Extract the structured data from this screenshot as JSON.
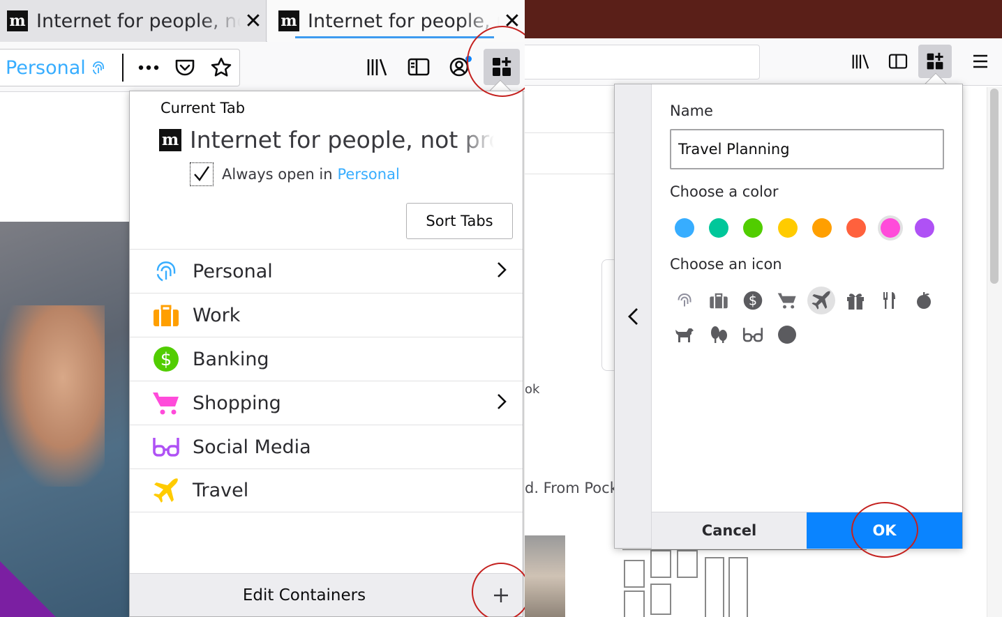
{
  "left": {
    "tabs": [
      {
        "title": "Internet for people, not profit",
        "favicon": "m",
        "close": "✕"
      },
      {
        "title": "Internet for people, not profit",
        "favicon": "m",
        "close": "✕"
      }
    ],
    "navbar": {
      "container_label": "Personal",
      "icons": [
        "fingerprint-icon",
        "more-icon",
        "pocket-icon",
        "star-icon",
        "library-icon",
        "sidebar-icon",
        "account-icon",
        "containers-icon"
      ]
    },
    "popup": {
      "current_tab_label": "Current Tab",
      "current_tab_title": "Internet for people, not profit",
      "favicon": "m",
      "always_open_prefix": "Always open in",
      "always_open_container": "Personal",
      "always_open_checked": true,
      "sort_tabs_label": "Sort Tabs",
      "containers": [
        {
          "name": "Personal",
          "icon": "fingerprint-icon",
          "color": "#37adff",
          "has_tabs": true
        },
        {
          "name": "Work",
          "icon": "briefcase-icon",
          "color": "#ff9f00",
          "has_tabs": false
        },
        {
          "name": "Banking",
          "icon": "dollar-icon",
          "color": "#51cd00",
          "has_tabs": false
        },
        {
          "name": "Shopping",
          "icon": "cart-icon",
          "color": "#ff4bda",
          "has_tabs": true
        },
        {
          "name": "Social Media",
          "icon": "glasses-icon",
          "color": "#af51f5",
          "has_tabs": false
        },
        {
          "name": "Travel",
          "icon": "plane-icon",
          "color": "#ffcb00",
          "has_tabs": false
        }
      ],
      "edit_containers_label": "Edit Containers",
      "add_label": "+"
    }
  },
  "right": {
    "content": {
      "fb_caption": "ok",
      "pocket_caption": "d. From Pock"
    },
    "panel": {
      "name_label": "Name",
      "name_value": "Travel Planning",
      "color_label": "Choose a color",
      "colors": [
        {
          "name": "blue",
          "hex": "#37adff",
          "selected": false
        },
        {
          "name": "turquoise",
          "hex": "#00c79a",
          "selected": false
        },
        {
          "name": "green",
          "hex": "#51cd00",
          "selected": false
        },
        {
          "name": "yellow",
          "hex": "#ffcb00",
          "selected": false
        },
        {
          "name": "orange",
          "hex": "#ff9f00",
          "selected": false
        },
        {
          "name": "red",
          "hex": "#ff613d",
          "selected": false
        },
        {
          "name": "pink",
          "hex": "#ff4bda",
          "selected": true
        },
        {
          "name": "purple",
          "hex": "#af51f5",
          "selected": false
        }
      ],
      "icon_label": "Choose an icon",
      "icons": [
        {
          "name": "fingerprint-icon",
          "selected": false
        },
        {
          "name": "briefcase-icon",
          "selected": false
        },
        {
          "name": "dollar-icon",
          "selected": false
        },
        {
          "name": "cart-icon",
          "selected": false
        },
        {
          "name": "plane-icon",
          "selected": true
        },
        {
          "name": "gift-icon",
          "selected": false
        },
        {
          "name": "food-icon",
          "selected": false
        },
        {
          "name": "fruit-icon",
          "selected": false
        },
        {
          "name": "pet-icon",
          "selected": false
        },
        {
          "name": "tree-icon",
          "selected": false
        },
        {
          "name": "glasses-icon",
          "selected": false
        },
        {
          "name": "circle-icon",
          "selected": false
        }
      ],
      "cancel_label": "Cancel",
      "ok_label": "OK"
    }
  },
  "colors": {
    "accent": "#0a84ff",
    "highlight": "#37adff",
    "annotation_ring": "#c4211f",
    "right_titlebar": "#5a1f18"
  }
}
